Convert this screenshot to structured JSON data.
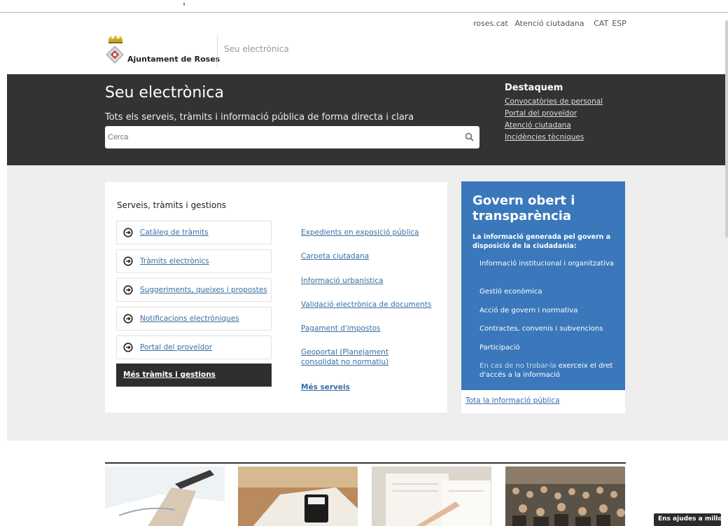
{
  "header": {
    "toplinks": [
      "roses.cat",
      "Atenció ciutadana"
    ],
    "langs": [
      "CAT",
      "ESP"
    ],
    "logo_text": "Ajuntament de Roses",
    "section_label": "Seu electrònica"
  },
  "hero": {
    "title": "Seu electrònica",
    "subtitle": "Tots els serveis, tràmits i informació pública de forma directa i clara",
    "search_placeholder": "Cerca",
    "destaquem_title": "Destaquem",
    "destaquem_links": [
      "Convocatòries de personal",
      "Portal del proveïdor",
      "Atenció ciutadana",
      "Incidències tècniques"
    ]
  },
  "services": {
    "title": "Serveis, tràmits i gestions",
    "buttons": [
      "Catàleg de tràmits",
      "Tràmits electrònics",
      "Suggeriments, queixes i propostes",
      "Notificacions electròniques",
      "Portal del proveïdor"
    ],
    "more_button": "Més tràmits i gestions",
    "links": [
      "Expedients en exposició pública",
      "Carpeta ciutadana",
      "Informació urbanística",
      "Validació electrònica de documents",
      "Pagament d'impostos",
      "Geoportal (Planejament consolidat no normatiu)"
    ],
    "more_link": "Més serveis"
  },
  "govern": {
    "title": "Govern obert i transparència",
    "description": "La informació generada pel govern a disposició de la ciudadania:",
    "items": [
      "Informació institucional i organitzativa",
      "Gestió econòmica",
      "Acció de govern i normativa",
      "Contractes, convenis i subvencions",
      "Participació"
    ],
    "note_part1": "En cas de no trobar-la ",
    "note_part2": "exerceix el dret d'accés a la informació",
    "footer_link": "Tota la informació pública"
  },
  "help_button": "Ens ajudes a millorar?",
  "colors": {
    "hero_bg": "#333333",
    "accent_blue": "#3a78bb",
    "link_blue": "#3a6fa3",
    "section_bg": "#eeeeee"
  }
}
